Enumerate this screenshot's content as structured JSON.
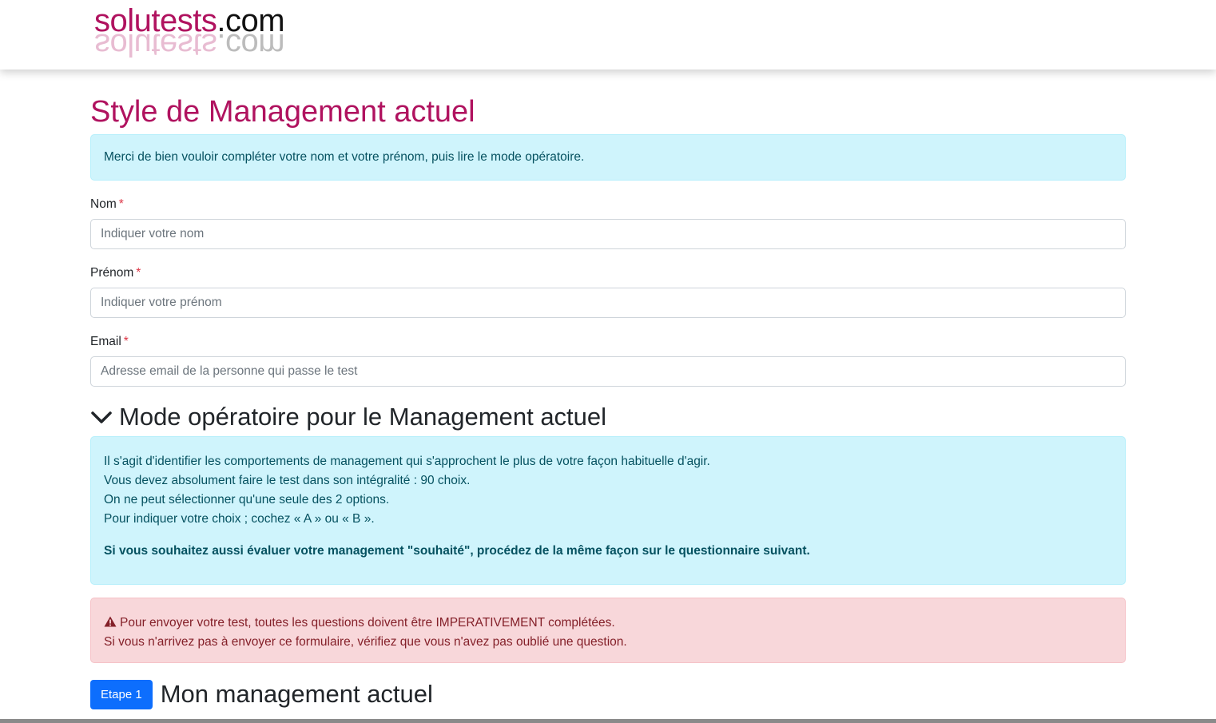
{
  "header": {
    "logo_brand": "solutests",
    "logo_tld": ".com"
  },
  "page": {
    "title": "Style de Management actuel",
    "intro_text": "Merci de bien vouloir compléter votre nom et votre prénom, puis lire le mode opératoire."
  },
  "form": {
    "nom": {
      "label": "Nom",
      "required_mark": "*",
      "placeholder": "Indiquer votre nom",
      "value": ""
    },
    "prenom": {
      "label": "Prénom",
      "required_mark": "*",
      "placeholder": "Indiquer votre prénom",
      "value": ""
    },
    "email": {
      "label": "Email",
      "required_mark": "*",
      "placeholder": "Adresse email de la personne qui passe le test",
      "value": ""
    }
  },
  "mode": {
    "heading": "Mode opératoire pour le Management actuel",
    "lines": [
      "Il s'agit d'identifier les comportements de management qui s'approchent le plus de votre façon habituelle d'agir.",
      "Vous devez absolument faire le test dans son intégralité : 90 choix.",
      "On ne peut sélectionner qu'une seule des 2 options.",
      "Pour indiquer votre choix ; cochez « A » ou « B »."
    ],
    "strong_note": "Si vous souhaitez aussi évaluer votre management \"souhaité\", procédez de la même façon sur le questionnaire suivant."
  },
  "warning": {
    "line1": "Pour envoyer votre test, toutes les questions doivent être IMPERATIVEMENT complétées.",
    "line2": "Si vous n'arrivez pas à envoyer ce formulaire, vérifiez que vous n'avez pas oublié une question."
  },
  "step": {
    "badge": "Etape 1",
    "title": "Mon management actuel"
  },
  "colors": {
    "brand": "#b0125f",
    "info_bg": "#cff4fc",
    "danger_bg": "#f8d7da",
    "primary": "#0d6efd"
  },
  "icons": {
    "chevron": "chevron-down-icon",
    "warning": "warning-triangle-icon"
  }
}
